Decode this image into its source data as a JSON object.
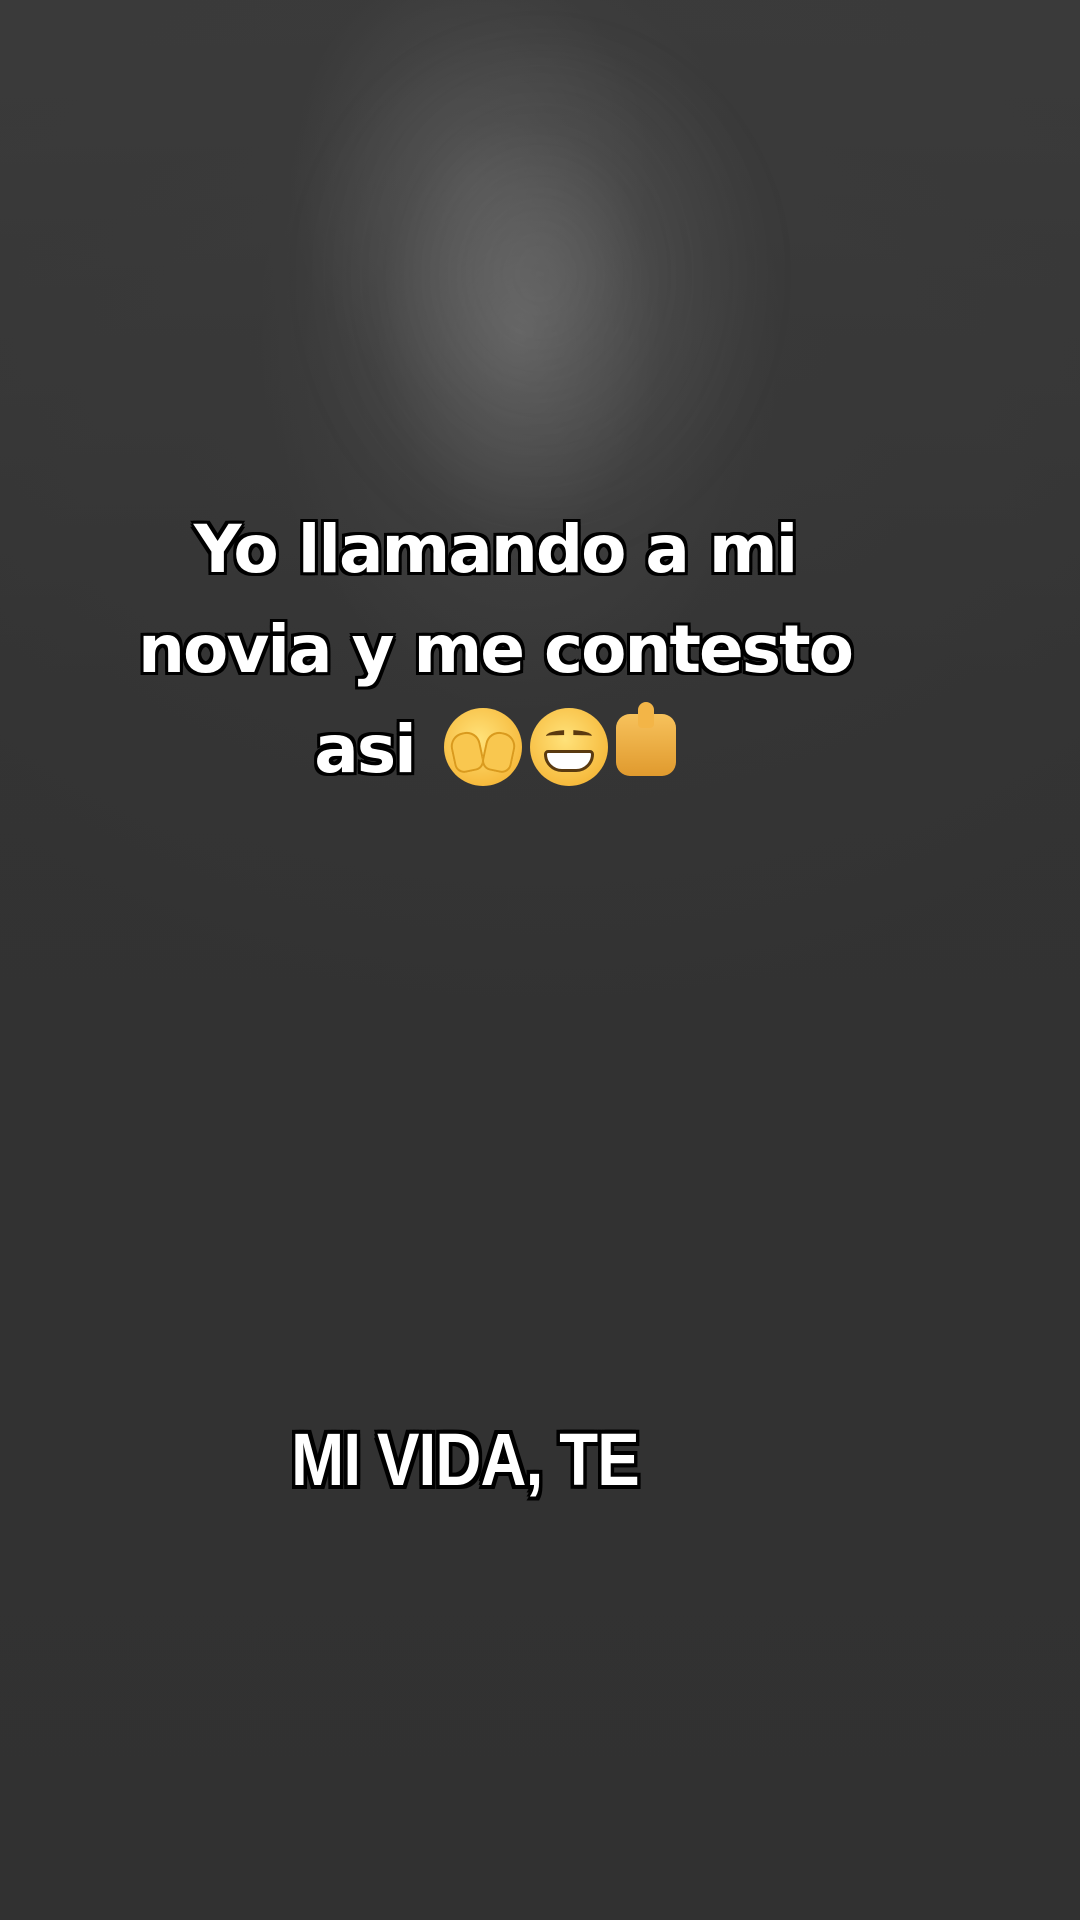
{
  "caption": {
    "line1": "Yo llamando a mi",
    "line2": "novia y me contesto",
    "line3_text": "asi",
    "emojis": [
      "face-with-hand-over-eyes-emoji",
      "grinning-face-emoji",
      "pointing-hand-emoji"
    ]
  },
  "subtitle": {
    "text": "MI VIDA, TE"
  },
  "colors": {
    "background": "#323232",
    "text": "#ffffff",
    "outline": "#000000"
  }
}
